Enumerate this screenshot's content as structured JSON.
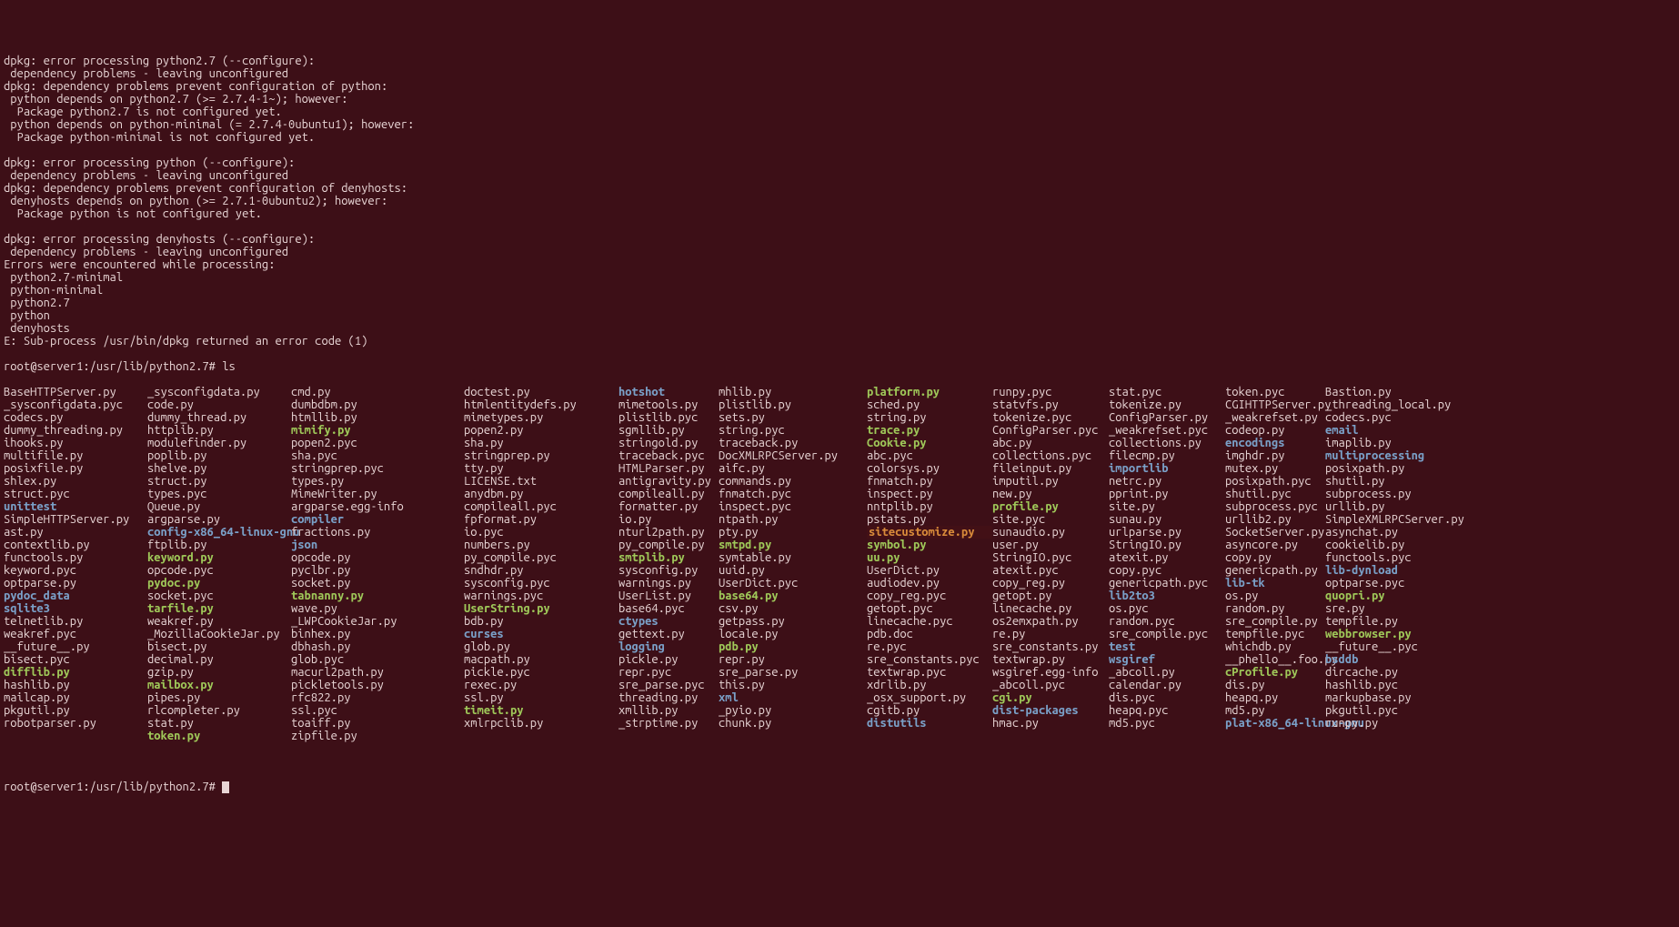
{
  "output_lines": [
    "dpkg: error processing python2.7 (--configure):",
    " dependency problems - leaving unconfigured",
    "dpkg: dependency problems prevent configuration of python:",
    " python depends on python2.7 (>= 2.7.4-1~); however:",
    "  Package python2.7 is not configured yet.",
    " python depends on python-minimal (= 2.7.4-0ubuntu1); however:",
    "  Package python-minimal is not configured yet.",
    "",
    "dpkg: error processing python (--configure):",
    " dependency problems - leaving unconfigured",
    "dpkg: dependency problems prevent configuration of denyhosts:",
    " denyhosts depends on python (>= 2.7.1-0ubuntu2); however:",
    "  Package python is not configured yet.",
    "",
    "dpkg: error processing denyhosts (--configure):",
    " dependency problems - leaving unconfigured",
    "Errors were encountered while processing:",
    " python2.7-minimal",
    " python-minimal",
    " python2.7",
    " python",
    " denyhosts",
    "E: Sub-process /usr/bin/dpkg returned an error code (1)"
  ],
  "prompt1": "root@server1:/usr/lib/python2.7# ",
  "command1": "ls",
  "prompt2": "root@server1:/usr/lib/python2.7# ",
  "ls_columns": [
    [
      {
        "n": "BaseHTTPServer.py",
        "t": "f"
      },
      {
        "n": "Bastion.py",
        "t": "f"
      },
      {
        "n": "CGIHTTPServer.py",
        "t": "f"
      },
      {
        "n": "ConfigParser.py",
        "t": "f"
      },
      {
        "n": "ConfigParser.pyc",
        "t": "f"
      },
      {
        "n": "Cookie.py",
        "t": "exe"
      },
      {
        "n": "DocXMLRPCServer.py",
        "t": "f"
      },
      {
        "n": "HTMLParser.py",
        "t": "f"
      },
      {
        "n": "LICENSE.txt",
        "t": "f"
      },
      {
        "n": "MimeWriter.py",
        "t": "f"
      },
      {
        "n": "Queue.py",
        "t": "f"
      },
      {
        "n": "SimpleHTTPServer.py",
        "t": "f"
      },
      {
        "n": "SimpleXMLRPCServer.py",
        "t": "f"
      },
      {
        "n": "SocketServer.py",
        "t": "f"
      },
      {
        "n": "StringIO.py",
        "t": "f"
      },
      {
        "n": "StringIO.pyc",
        "t": "f"
      },
      {
        "n": "UserDict.py",
        "t": "f"
      },
      {
        "n": "UserDict.pyc",
        "t": "f"
      },
      {
        "n": "UserList.py",
        "t": "f"
      },
      {
        "n": "UserString.py",
        "t": "exe"
      },
      {
        "n": "_LWPCookieJar.py",
        "t": "f"
      },
      {
        "n": "_MozillaCookieJar.py",
        "t": "f"
      },
      {
        "n": "__future__.py",
        "t": "f"
      },
      {
        "n": "__future__.pyc",
        "t": "f"
      },
      {
        "n": "__phello__.foo.py",
        "t": "f"
      },
      {
        "n": "_abcoll.py",
        "t": "f"
      },
      {
        "n": "_abcoll.pyc",
        "t": "f"
      },
      {
        "n": "_osx_support.py",
        "t": "f"
      },
      {
        "n": "_pyio.py",
        "t": "f"
      },
      {
        "n": "_strptime.py",
        "t": "f"
      }
    ],
    [
      {
        "n": "_sysconfigdata.py",
        "t": "f"
      },
      {
        "n": "_sysconfigdata.pyc",
        "t": "f"
      },
      {
        "n": "_threading_local.py",
        "t": "f"
      },
      {
        "n": "_weakrefset.py",
        "t": "f"
      },
      {
        "n": "_weakrefset.pyc",
        "t": "f"
      },
      {
        "n": "abc.py",
        "t": "f"
      },
      {
        "n": "abc.pyc",
        "t": "f"
      },
      {
        "n": "aifc.py",
        "t": "f"
      },
      {
        "n": "antigravity.py",
        "t": "f"
      },
      {
        "n": "anydbm.py",
        "t": "f"
      },
      {
        "n": "argparse.egg-info",
        "t": "f"
      },
      {
        "n": "argparse.py",
        "t": "f"
      },
      {
        "n": "ast.py",
        "t": "f"
      },
      {
        "n": "asynchat.py",
        "t": "f"
      },
      {
        "n": "asyncore.py",
        "t": "f"
      },
      {
        "n": "atexit.py",
        "t": "f"
      },
      {
        "n": "atexit.pyc",
        "t": "f"
      },
      {
        "n": "audiodev.py",
        "t": "f"
      },
      {
        "n": "base64.py",
        "t": "exe"
      },
      {
        "n": "base64.pyc",
        "t": "f"
      },
      {
        "n": "bdb.py",
        "t": "f"
      },
      {
        "n": "binhex.py",
        "t": "f"
      },
      {
        "n": "bisect.py",
        "t": "f"
      },
      {
        "n": "bisect.pyc",
        "t": "f"
      },
      {
        "n": "bsddb",
        "t": "dir"
      },
      {
        "n": "cProfile.py",
        "t": "exe"
      },
      {
        "n": "calendar.py",
        "t": "f"
      },
      {
        "n": "cgi.py",
        "t": "exe"
      },
      {
        "n": "cgitb.py",
        "t": "f"
      },
      {
        "n": "chunk.py",
        "t": "f"
      }
    ],
    [
      {
        "n": "cmd.py",
        "t": "f"
      },
      {
        "n": "code.py",
        "t": "f"
      },
      {
        "n": "codecs.py",
        "t": "f"
      },
      {
        "n": "codecs.pyc",
        "t": "f"
      },
      {
        "n": "codeop.py",
        "t": "f"
      },
      {
        "n": "collections.py",
        "t": "f"
      },
      {
        "n": "collections.pyc",
        "t": "f"
      },
      {
        "n": "colorsys.py",
        "t": "f"
      },
      {
        "n": "commands.py",
        "t": "f"
      },
      {
        "n": "compileall.py",
        "t": "f"
      },
      {
        "n": "compileall.pyc",
        "t": "f"
      },
      {
        "n": "compiler",
        "t": "dir"
      },
      {
        "n": "config-x86_64-linux-gnu",
        "t": "dir"
      },
      {
        "n": "contextlib.py",
        "t": "f"
      },
      {
        "n": "cookielib.py",
        "t": "f"
      },
      {
        "n": "copy.py",
        "t": "f"
      },
      {
        "n": "copy.pyc",
        "t": "f"
      },
      {
        "n": "copy_reg.py",
        "t": "f"
      },
      {
        "n": "copy_reg.pyc",
        "t": "f"
      },
      {
        "n": "csv.py",
        "t": "f"
      },
      {
        "n": "ctypes",
        "t": "dir"
      },
      {
        "n": "curses",
        "t": "dir"
      },
      {
        "n": "dbhash.py",
        "t": "f"
      },
      {
        "n": "decimal.py",
        "t": "f"
      },
      {
        "n": "difflib.py",
        "t": "exe"
      },
      {
        "n": "dircache.py",
        "t": "f"
      },
      {
        "n": "dis.py",
        "t": "f"
      },
      {
        "n": "dis.pyc",
        "t": "f"
      },
      {
        "n": "dist-packages",
        "t": "dir"
      },
      {
        "n": "distutils",
        "t": "dir"
      }
    ],
    [
      {
        "n": "doctest.py",
        "t": "f"
      },
      {
        "n": "dumbdbm.py",
        "t": "f"
      },
      {
        "n": "dummy_thread.py",
        "t": "f"
      },
      {
        "n": "dummy_threading.py",
        "t": "f"
      },
      {
        "n": "email",
        "t": "dir"
      },
      {
        "n": "encodings",
        "t": "dir"
      },
      {
        "n": "filecmp.py",
        "t": "f"
      },
      {
        "n": "fileinput.py",
        "t": "f"
      },
      {
        "n": "fnmatch.py",
        "t": "f"
      },
      {
        "n": "fnmatch.pyc",
        "t": "f"
      },
      {
        "n": "formatter.py",
        "t": "f"
      },
      {
        "n": "fpformat.py",
        "t": "f"
      },
      {
        "n": "fractions.py",
        "t": "f"
      },
      {
        "n": "ftplib.py",
        "t": "f"
      },
      {
        "n": "functools.py",
        "t": "f"
      },
      {
        "n": "functools.pyc",
        "t": "f"
      },
      {
        "n": "genericpath.py",
        "t": "f"
      },
      {
        "n": "genericpath.pyc",
        "t": "f"
      },
      {
        "n": "getopt.py",
        "t": "f"
      },
      {
        "n": "getopt.pyc",
        "t": "f"
      },
      {
        "n": "getpass.py",
        "t": "f"
      },
      {
        "n": "gettext.py",
        "t": "f"
      },
      {
        "n": "glob.py",
        "t": "f"
      },
      {
        "n": "glob.pyc",
        "t": "f"
      },
      {
        "n": "gzip.py",
        "t": "f"
      },
      {
        "n": "hashlib.py",
        "t": "f"
      },
      {
        "n": "hashlib.pyc",
        "t": "f"
      },
      {
        "n": "heapq.py",
        "t": "f"
      },
      {
        "n": "heapq.pyc",
        "t": "f"
      },
      {
        "n": "hmac.py",
        "t": "f"
      }
    ],
    [
      {
        "n": "hotshot",
        "t": "dir"
      },
      {
        "n": "htmlentitydefs.py",
        "t": "f"
      },
      {
        "n": "htmllib.py",
        "t": "f"
      },
      {
        "n": "httplib.py",
        "t": "f"
      },
      {
        "n": "ihooks.py",
        "t": "f"
      },
      {
        "n": "imaplib.py",
        "t": "f"
      },
      {
        "n": "imghdr.py",
        "t": "f"
      },
      {
        "n": "importlib",
        "t": "dir"
      },
      {
        "n": "imputil.py",
        "t": "f"
      },
      {
        "n": "inspect.py",
        "t": "f"
      },
      {
        "n": "inspect.pyc",
        "t": "f"
      },
      {
        "n": "io.py",
        "t": "f"
      },
      {
        "n": "io.pyc",
        "t": "f"
      },
      {
        "n": "json",
        "t": "dir"
      },
      {
        "n": "keyword.py",
        "t": "exe"
      },
      {
        "n": "keyword.pyc",
        "t": "f"
      },
      {
        "n": "lib-dynload",
        "t": "dir"
      },
      {
        "n": "lib-tk",
        "t": "dir"
      },
      {
        "n": "lib2to3",
        "t": "dir"
      },
      {
        "n": "linecache.py",
        "t": "f"
      },
      {
        "n": "linecache.pyc",
        "t": "f"
      },
      {
        "n": "locale.py",
        "t": "f"
      },
      {
        "n": "logging",
        "t": "dir"
      },
      {
        "n": "macpath.py",
        "t": "f"
      },
      {
        "n": "macurl2path.py",
        "t": "f"
      },
      {
        "n": "mailbox.py",
        "t": "exe"
      },
      {
        "n": "mailcap.py",
        "t": "f"
      },
      {
        "n": "markupbase.py",
        "t": "f"
      },
      {
        "n": "md5.py",
        "t": "f"
      },
      {
        "n": "md5.pyc",
        "t": "f"
      }
    ],
    [
      {
        "n": "mhlib.py",
        "t": "f"
      },
      {
        "n": "mimetools.py",
        "t": "f"
      },
      {
        "n": "mimetypes.py",
        "t": "f"
      },
      {
        "n": "mimify.py",
        "t": "exe"
      },
      {
        "n": "modulefinder.py",
        "t": "f"
      },
      {
        "n": "multifile.py",
        "t": "f"
      },
      {
        "n": "multiprocessing",
        "t": "dir"
      },
      {
        "n": "mutex.py",
        "t": "f"
      },
      {
        "n": "netrc.py",
        "t": "f"
      },
      {
        "n": "new.py",
        "t": "f"
      },
      {
        "n": "nntplib.py",
        "t": "f"
      },
      {
        "n": "ntpath.py",
        "t": "f"
      },
      {
        "n": "nturl2path.py",
        "t": "f"
      },
      {
        "n": "numbers.py",
        "t": "f"
      },
      {
        "n": "opcode.py",
        "t": "f"
      },
      {
        "n": "opcode.pyc",
        "t": "f"
      },
      {
        "n": "optparse.py",
        "t": "f"
      },
      {
        "n": "optparse.pyc",
        "t": "f"
      },
      {
        "n": "os.py",
        "t": "f"
      },
      {
        "n": "os.pyc",
        "t": "f"
      },
      {
        "n": "os2emxpath.py",
        "t": "f"
      },
      {
        "n": "pdb.doc",
        "t": "f"
      },
      {
        "n": "pdb.py",
        "t": "exe"
      },
      {
        "n": "pickle.py",
        "t": "f"
      },
      {
        "n": "pickle.pyc",
        "t": "f"
      },
      {
        "n": "pickletools.py",
        "t": "f"
      },
      {
        "n": "pipes.py",
        "t": "f"
      },
      {
        "n": "pkgutil.py",
        "t": "f"
      },
      {
        "n": "pkgutil.pyc",
        "t": "f"
      },
      {
        "n": "plat-x86_64-linux-gnu",
        "t": "dir"
      }
    ],
    [
      {
        "n": "platform.py",
        "t": "exe"
      },
      {
        "n": "plistlib.py",
        "t": "f"
      },
      {
        "n": "plistlib.pyc",
        "t": "f"
      },
      {
        "n": "popen2.py",
        "t": "f"
      },
      {
        "n": "popen2.pyc",
        "t": "f"
      },
      {
        "n": "poplib.py",
        "t": "f"
      },
      {
        "n": "posixfile.py",
        "t": "f"
      },
      {
        "n": "posixpath.py",
        "t": "f"
      },
      {
        "n": "posixpath.pyc",
        "t": "f"
      },
      {
        "n": "pprint.py",
        "t": "f"
      },
      {
        "n": "profile.py",
        "t": "exe"
      },
      {
        "n": "pstats.py",
        "t": "f"
      },
      {
        "n": "pty.py",
        "t": "f"
      },
      {
        "n": "py_compile.py",
        "t": "f"
      },
      {
        "n": "py_compile.pyc",
        "t": "f"
      },
      {
        "n": "pyclbr.py",
        "t": "f"
      },
      {
        "n": "pydoc.py",
        "t": "exe"
      },
      {
        "n": "pydoc_data",
        "t": "dir"
      },
      {
        "n": "quopri.py",
        "t": "exe"
      },
      {
        "n": "random.py",
        "t": "f"
      },
      {
        "n": "random.pyc",
        "t": "f"
      },
      {
        "n": "re.py",
        "t": "f"
      },
      {
        "n": "re.pyc",
        "t": "f"
      },
      {
        "n": "repr.py",
        "t": "f"
      },
      {
        "n": "repr.pyc",
        "t": "f"
      },
      {
        "n": "rexec.py",
        "t": "f"
      },
      {
        "n": "rfc822.py",
        "t": "f"
      },
      {
        "n": "rlcompleter.py",
        "t": "f"
      },
      {
        "n": "robotparser.py",
        "t": "f"
      },
      {
        "n": "runpy.py",
        "t": "f"
      }
    ],
    [
      {
        "n": "runpy.pyc",
        "t": "f"
      },
      {
        "n": "sched.py",
        "t": "f"
      },
      {
        "n": "sets.py",
        "t": "f"
      },
      {
        "n": "sgmllib.py",
        "t": "f"
      },
      {
        "n": "sha.py",
        "t": "f"
      },
      {
        "n": "sha.pyc",
        "t": "f"
      },
      {
        "n": "shelve.py",
        "t": "f"
      },
      {
        "n": "shlex.py",
        "t": "f"
      },
      {
        "n": "shutil.py",
        "t": "f"
      },
      {
        "n": "shutil.pyc",
        "t": "f"
      },
      {
        "n": "site.py",
        "t": "f"
      },
      {
        "n": "site.pyc",
        "t": "f"
      },
      {
        "n": "sitecustomize.py",
        "t": "spc"
      },
      {
        "n": "smtpd.py",
        "t": "exe"
      },
      {
        "n": "smtplib.py",
        "t": "exe"
      },
      {
        "n": "sndhdr.py",
        "t": "f"
      },
      {
        "n": "socket.py",
        "t": "f"
      },
      {
        "n": "socket.pyc",
        "t": "f"
      },
      {
        "n": "sqlite3",
        "t": "dir"
      },
      {
        "n": "sre.py",
        "t": "f"
      },
      {
        "n": "sre_compile.py",
        "t": "f"
      },
      {
        "n": "sre_compile.pyc",
        "t": "f"
      },
      {
        "n": "sre_constants.py",
        "t": "f"
      },
      {
        "n": "sre_constants.pyc",
        "t": "f"
      },
      {
        "n": "sre_parse.py",
        "t": "f"
      },
      {
        "n": "sre_parse.pyc",
        "t": "f"
      },
      {
        "n": "ssl.py",
        "t": "f"
      },
      {
        "n": "ssl.pyc",
        "t": "f"
      },
      {
        "n": "stat.py",
        "t": "f"
      }
    ],
    [
      {
        "n": "stat.pyc",
        "t": "f"
      },
      {
        "n": "statvfs.py",
        "t": "f"
      },
      {
        "n": "string.py",
        "t": "f"
      },
      {
        "n": "string.pyc",
        "t": "f"
      },
      {
        "n": "stringold.py",
        "t": "f"
      },
      {
        "n": "stringprep.py",
        "t": "f"
      },
      {
        "n": "stringprep.pyc",
        "t": "f"
      },
      {
        "n": "struct.py",
        "t": "f"
      },
      {
        "n": "struct.pyc",
        "t": "f"
      },
      {
        "n": "subprocess.py",
        "t": "f"
      },
      {
        "n": "subprocess.pyc",
        "t": "f"
      },
      {
        "n": "sunau.py",
        "t": "f"
      },
      {
        "n": "sunaudio.py",
        "t": "f"
      },
      {
        "n": "symbol.py",
        "t": "exe"
      },
      {
        "n": "symtable.py",
        "t": "f"
      },
      {
        "n": "sysconfig.py",
        "t": "f"
      },
      {
        "n": "sysconfig.pyc",
        "t": "f"
      },
      {
        "n": "tabnanny.py",
        "t": "exe"
      },
      {
        "n": "tarfile.py",
        "t": "exe"
      },
      {
        "n": "telnetlib.py",
        "t": "f"
      },
      {
        "n": "tempfile.py",
        "t": "f"
      },
      {
        "n": "tempfile.pyc",
        "t": "f"
      },
      {
        "n": "test",
        "t": "dir"
      },
      {
        "n": "textwrap.py",
        "t": "f"
      },
      {
        "n": "textwrap.pyc",
        "t": "f"
      },
      {
        "n": "this.py",
        "t": "f"
      },
      {
        "n": "threading.py",
        "t": "f"
      },
      {
        "n": "timeit.py",
        "t": "exe"
      },
      {
        "n": "toaiff.py",
        "t": "f"
      },
      {
        "n": "token.py",
        "t": "exe"
      }
    ],
    [
      {
        "n": "token.pyc",
        "t": "f"
      },
      {
        "n": "tokenize.py",
        "t": "f"
      },
      {
        "n": "tokenize.pyc",
        "t": "f"
      },
      {
        "n": "trace.py",
        "t": "exe"
      },
      {
        "n": "traceback.py",
        "t": "f"
      },
      {
        "n": "traceback.pyc",
        "t": "f"
      },
      {
        "n": "tty.py",
        "t": "f"
      },
      {
        "n": "types.py",
        "t": "f"
      },
      {
        "n": "types.pyc",
        "t": "f"
      },
      {
        "n": "unittest",
        "t": "dir"
      },
      {
        "n": "urllib.py",
        "t": "f"
      },
      {
        "n": "urllib2.py",
        "t": "f"
      },
      {
        "n": "urlparse.py",
        "t": "f"
      },
      {
        "n": "user.py",
        "t": "f"
      },
      {
        "n": "uu.py",
        "t": "exe"
      },
      {
        "n": "uuid.py",
        "t": "f"
      },
      {
        "n": "warnings.py",
        "t": "f"
      },
      {
        "n": "warnings.pyc",
        "t": "f"
      },
      {
        "n": "wave.py",
        "t": "f"
      },
      {
        "n": "weakref.py",
        "t": "f"
      },
      {
        "n": "weakref.pyc",
        "t": "f"
      },
      {
        "n": "webbrowser.py",
        "t": "exe"
      },
      {
        "n": "whichdb.py",
        "t": "f"
      },
      {
        "n": "wsgiref",
        "t": "dir"
      },
      {
        "n": "wsgiref.egg-info",
        "t": "f"
      },
      {
        "n": "xdrlib.py",
        "t": "f"
      },
      {
        "n": "xml",
        "t": "dir"
      },
      {
        "n": "xmllib.py",
        "t": "f"
      },
      {
        "n": "xmlrpclib.py",
        "t": "f"
      },
      {
        "n": "zipfile.py",
        "t": "f"
      }
    ]
  ]
}
